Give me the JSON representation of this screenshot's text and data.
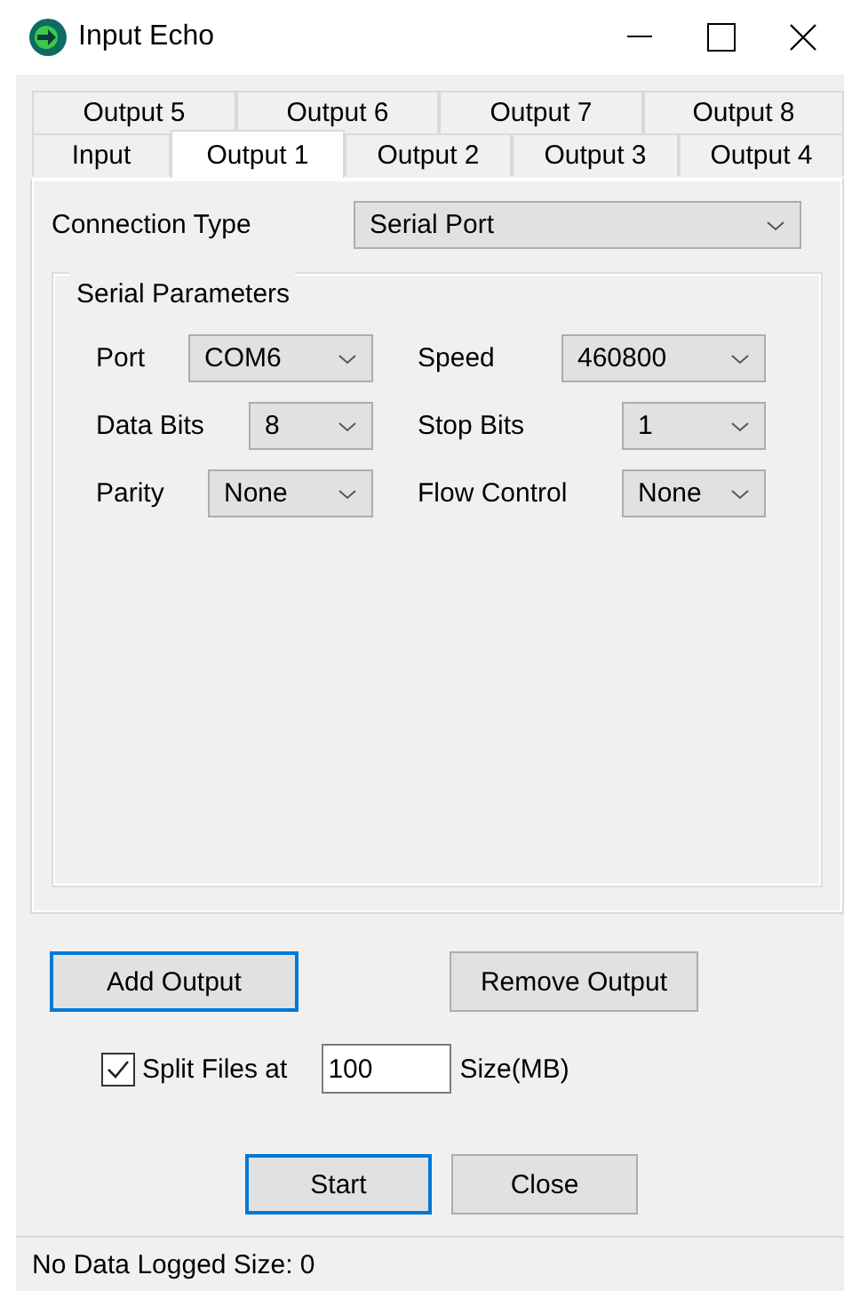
{
  "window": {
    "title": "Input Echo"
  },
  "tab_rows": [
    [
      {
        "label": "Output 5",
        "selected": false
      },
      {
        "label": "Output 6",
        "selected": false
      },
      {
        "label": "Output 7",
        "selected": false
      },
      {
        "label": "Output 8",
        "selected": false
      }
    ],
    [
      {
        "label": "Input",
        "selected": false
      },
      {
        "label": "Output 1",
        "selected": true
      },
      {
        "label": "Output 2",
        "selected": false
      },
      {
        "label": "Output 3",
        "selected": false
      },
      {
        "label": "Output 4",
        "selected": false
      }
    ]
  ],
  "connection_type": {
    "label": "Connection Type",
    "value": "Serial Port"
  },
  "serial_parameters": {
    "title": "Serial Parameters",
    "rows": [
      [
        {
          "label": "Port",
          "value": "COM6"
        },
        {
          "label": "Speed",
          "value": "460800"
        }
      ],
      [
        {
          "label": "Data Bits",
          "value": "8"
        },
        {
          "label": "Stop Bits",
          "value": "1"
        }
      ],
      [
        {
          "label": "Parity",
          "value": "None"
        },
        {
          "label": "Flow Control",
          "value": "None"
        }
      ]
    ]
  },
  "output_buttons": [
    {
      "label": "Add Output",
      "focused": true
    },
    {
      "label": "Remove Output",
      "focused": false
    }
  ],
  "split": {
    "label": "Split Files at",
    "checked": true,
    "value": "100",
    "unit": "Size(MB)"
  },
  "action_buttons": [
    {
      "label": "Start",
      "focused": true
    },
    {
      "label": "Close",
      "focused": false
    }
  ],
  "status_bar": "No Data Logged Size: 0"
}
